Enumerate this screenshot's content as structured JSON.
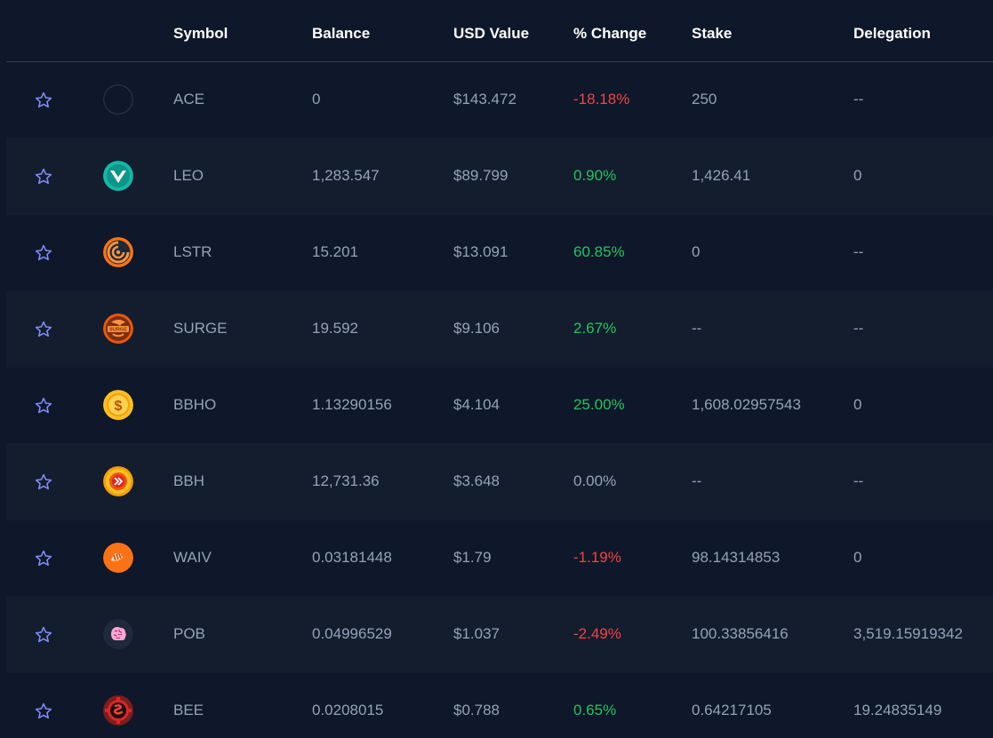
{
  "colors": {
    "background": "#0f172a",
    "row_alt": "#141d2e",
    "header_text": "#ffffff",
    "cell_text": "#94a3b8",
    "positive": "#22c55e",
    "negative": "#ef4444",
    "neutral": "#94a3b8",
    "star": "#818cf8"
  },
  "header": {
    "symbol": "Symbol",
    "balance": "Balance",
    "usd_value": "USD Value",
    "change": "% Change",
    "stake": "Stake",
    "delegation": "Delegation"
  },
  "rows": [
    {
      "symbol": "ACE",
      "balance": "0",
      "usd_value": "$143.472",
      "change": "-18.18%",
      "trend": "negative",
      "stake": "250",
      "delegation": "--",
      "icon": "ace-logo-icon"
    },
    {
      "symbol": "LEO",
      "balance": "1,283.547",
      "usd_value": "$89.799",
      "change": "0.90%",
      "trend": "positive",
      "stake": "1,426.41",
      "delegation": "0",
      "icon": "leo-logo-icon"
    },
    {
      "symbol": "LSTR",
      "balance": "15.201",
      "usd_value": "$13.091",
      "change": "60.85%",
      "trend": "positive",
      "stake": "0",
      "delegation": "--",
      "icon": "lstr-logo-icon"
    },
    {
      "symbol": "SURGE",
      "balance": "19.592",
      "usd_value": "$9.106",
      "change": "2.67%",
      "trend": "positive",
      "stake": "--",
      "delegation": "--",
      "icon": "surge-logo-icon"
    },
    {
      "symbol": "BBHO",
      "balance": "1.13290156",
      "usd_value": "$4.104",
      "change": "25.00%",
      "trend": "positive",
      "stake": "1,608.02957543",
      "delegation": "0",
      "icon": "bbho-logo-icon"
    },
    {
      "symbol": "BBH",
      "balance": "12,731.36",
      "usd_value": "$3.648",
      "change": "0.00%",
      "trend": "neutral",
      "stake": "--",
      "delegation": "--",
      "icon": "bbh-logo-icon"
    },
    {
      "symbol": "WAIV",
      "balance": "0.03181448",
      "usd_value": "$1.79",
      "change": "-1.19%",
      "trend": "negative",
      "stake": "98.14314853",
      "delegation": "0",
      "icon": "waiv-logo-icon"
    },
    {
      "symbol": "POB",
      "balance": "0.04996529",
      "usd_value": "$1.037",
      "change": "-2.49%",
      "trend": "negative",
      "stake": "100.33856416",
      "delegation": "3,519.15919342",
      "icon": "pob-brain-icon"
    },
    {
      "symbol": "BEE",
      "balance": "0.0208015",
      "usd_value": "$0.788",
      "change": "0.65%",
      "trend": "positive",
      "stake": "0.64217105",
      "delegation": "19.24835149",
      "icon": "bee-logo-icon"
    }
  ]
}
